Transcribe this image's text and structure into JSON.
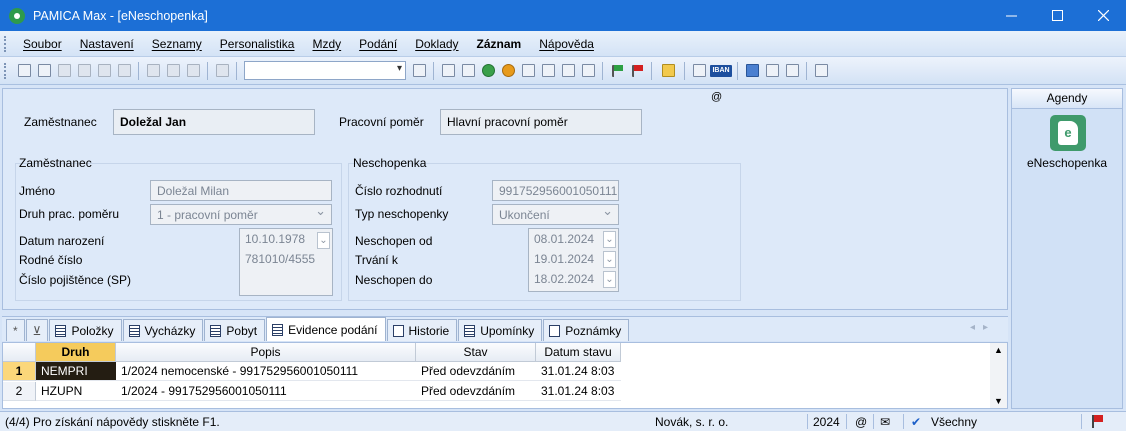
{
  "window": {
    "title": "PAMICA Max - [eNeschopenka]"
  },
  "menu": [
    "Soubor",
    "Nastavení",
    "Seznamy",
    "Personalistika",
    "Mzdy",
    "Podání",
    "Doklady",
    "Záznam",
    "Nápověda"
  ],
  "toolbar": {
    "combo_value": "",
    "iban_label": "IBAN"
  },
  "header": {
    "at_sign": "@",
    "employee_label": "Zaměstnanec",
    "employee_value": "Doležal Jan",
    "relation_label": "Pracovní poměr",
    "relation_value": "Hlavní pracovní poměr"
  },
  "employee_group": {
    "title": "Zaměstnanec",
    "name_label": "Jméno",
    "name_value": "Doležal Milan",
    "type_label": "Druh prac. poměru",
    "type_value": "1 - pracovní poměr",
    "birth_label": "Datum narození",
    "birth_value": "10.10.1978",
    "birthno_label": "Rodné číslo",
    "birthno_value": "781010/4555",
    "insured_label": "Číslo pojištěnce (SP)",
    "insured_value": ""
  },
  "sick_group": {
    "title": "Neschopenka",
    "decision_label": "Číslo rozhodnutí",
    "decision_value": "991752956001050111",
    "type_label": "Typ neschopenky",
    "type_value": "Ukončení",
    "from_label": "Neschopen od",
    "from_value": "08.01.2024",
    "until_label": "Trvání k",
    "until_value": "19.01.2024",
    "to_label": "Neschopen do",
    "to_value": "18.02.2024"
  },
  "tabs": {
    "star": "*",
    "items": [
      "Položky",
      "Vycházky",
      "Pobyt",
      "Evidence podání",
      "Historie",
      "Upomínky",
      "Poznámky"
    ]
  },
  "grid": {
    "columns": [
      "Druh",
      "Popis",
      "Stav",
      "Datum stavu"
    ],
    "rows": [
      {
        "num": "1",
        "druh": "NEMPRI",
        "popis": "1/2024  nemocenské - 991752956001050111",
        "stav": "Před odevzdáním",
        "datum": "31.01.24 8:03"
      },
      {
        "num": "2",
        "druh": "HZUPN",
        "popis": "1/2024 - 991752956001050111",
        "stav": "Před odevzdáním",
        "datum": "31.01.24 8:03"
      }
    ]
  },
  "side": {
    "header": "Agendy",
    "agenda_label": "eNeschopenka",
    "icon_letter": "e"
  },
  "status": {
    "help": "(4/4) Pro získání nápovědy stiskněte F1.",
    "company": "Novák, s. r. o.",
    "year": "2024",
    "at": "@",
    "filter": "Všechny"
  }
}
